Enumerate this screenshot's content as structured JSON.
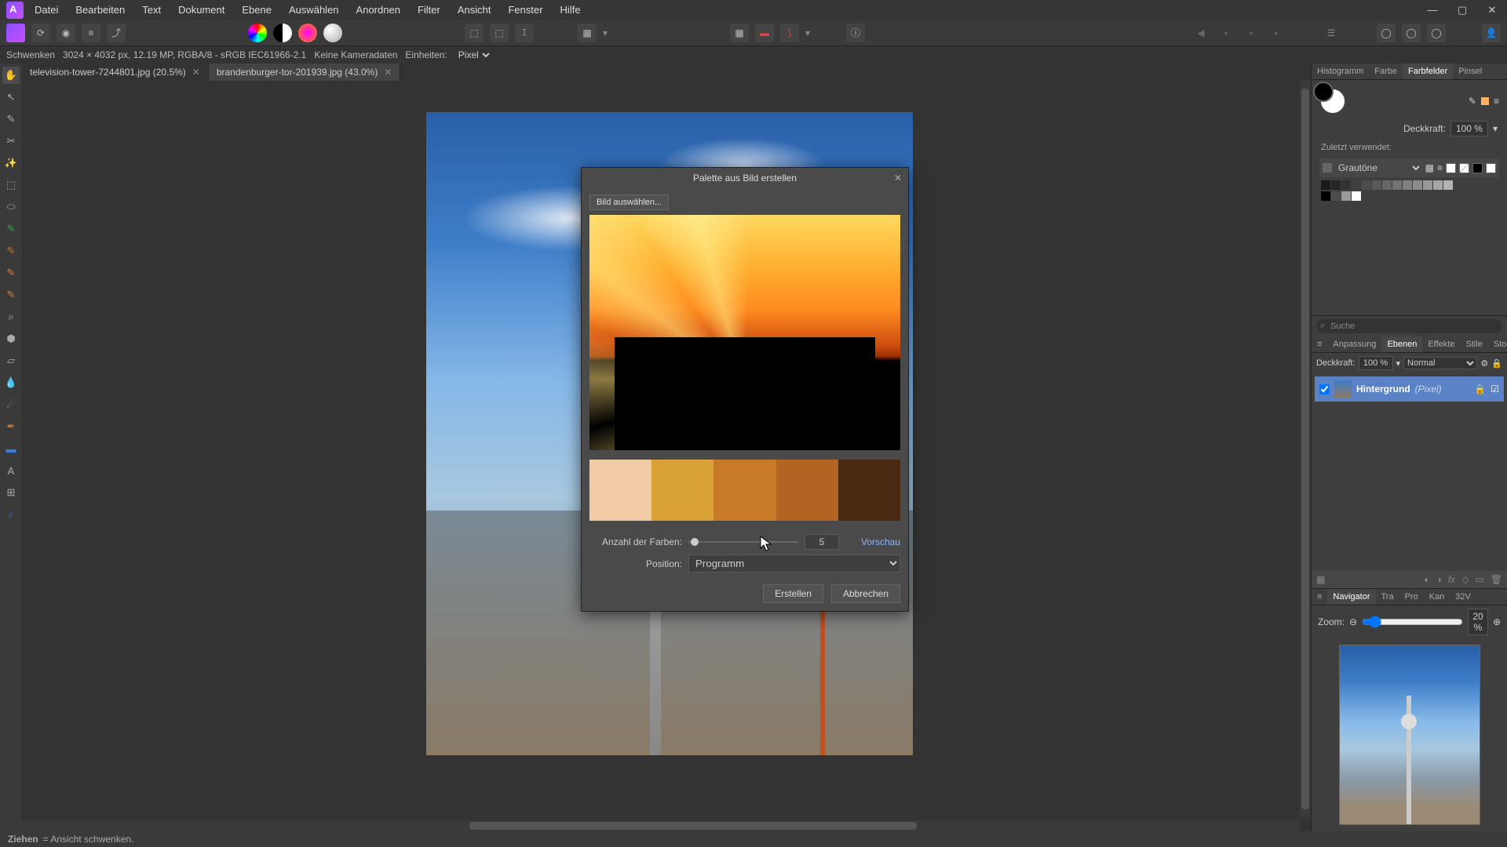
{
  "menu": [
    "Datei",
    "Bearbeiten",
    "Text",
    "Dokument",
    "Ebene",
    "Auswählen",
    "Anordnen",
    "Filter",
    "Ansicht",
    "Fenster",
    "Hilfe"
  ],
  "context": {
    "tool": "Schwenken",
    "info": "3024 × 4032 px, 12.19 MP, RGBA/8 - sRGB IEC61966-2.1",
    "camera": "Keine Kameradaten",
    "units_label": "Einheiten:",
    "units_value": "Pixel"
  },
  "tabs": [
    {
      "name": "television-tower-7244801.jpg (20.5%)",
      "active": true
    },
    {
      "name": "brandenburger-tor-201939.jpg (43.0%)",
      "active": false
    }
  ],
  "right": {
    "group1": [
      "Histogramm",
      "Farbe",
      "Farbfelder",
      "Pinsel"
    ],
    "group1_active": "Farbfelder",
    "opacity_label": "Deckkraft:",
    "opacity_value": "100 %",
    "recent_label": "Zuletzt verwendet:",
    "swatch_set": "Grautöne",
    "search_ph": "Suche",
    "group2": [
      "Anpassung",
      "Ebenen",
      "Effekte",
      "Stile",
      "Stock"
    ],
    "group2_active": "Ebenen",
    "layer_opacity_label": "Deckkraft:",
    "layer_opacity_value": "100 %",
    "blend": "Normal",
    "layer_name": "Hintergrund",
    "layer_type": "(Pixel)",
    "group3": [
      "Navigator",
      "Tra",
      "Pro",
      "Kan",
      "32V"
    ],
    "group3_active": "Navigator",
    "zoom_label": "Zoom:",
    "zoom_value": "20 %"
  },
  "dialog": {
    "title": "Palette aus Bild erstellen",
    "select_btn": "Bild auswählen...",
    "palette": [
      "#f0cba6",
      "#d9a136",
      "#c97a28",
      "#b36322",
      "#4a2a12"
    ],
    "count_label": "Anzahl der Farben:",
    "count_value": "5",
    "preview_link": "Vorschau",
    "position_label": "Position:",
    "position_value": "Programm",
    "create": "Erstellen",
    "cancel": "Abbrechen"
  },
  "status": {
    "action": "Ziehen",
    "desc": "= Ansicht schwenken."
  },
  "gray_swatches_top": [
    "#1a1a1a",
    "#262626",
    "#333333",
    "#404040",
    "#4d4d4d",
    "#595959",
    "#666666",
    "#737373",
    "#808080",
    "#8c8c8c",
    "#999999",
    "#a6a6a6",
    "#b3b3b3"
  ],
  "gray_swatches_bottom": [
    "#000000",
    "#4d4d4d",
    "#999999",
    "#ffffff"
  ]
}
